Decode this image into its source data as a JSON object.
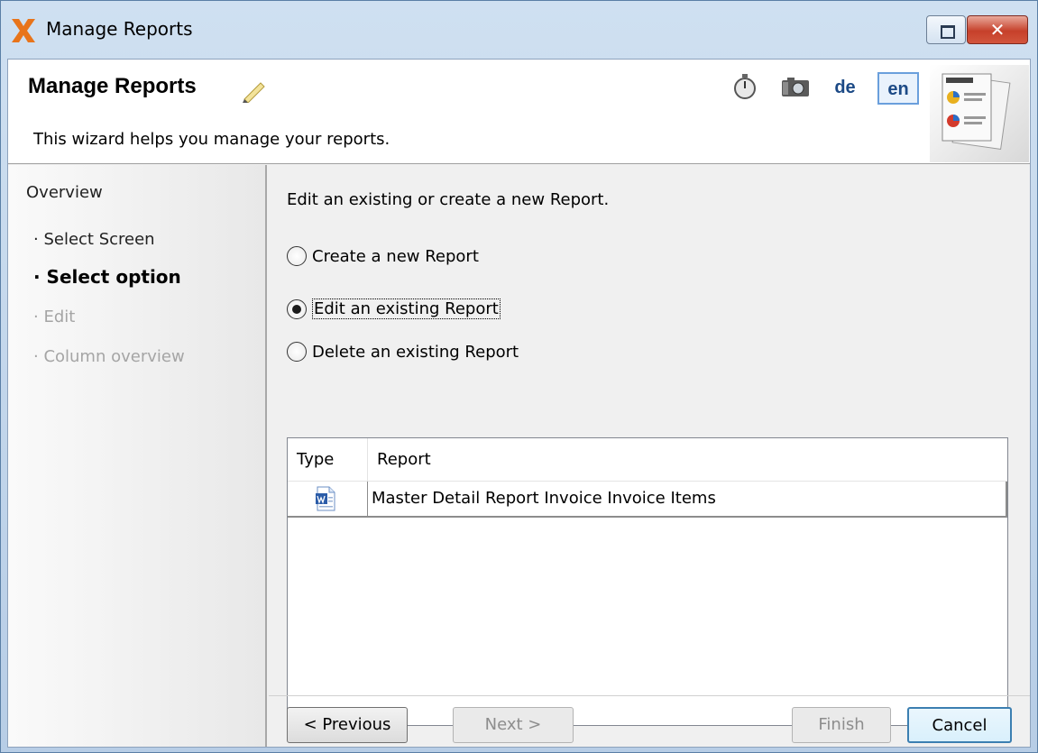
{
  "window": {
    "title": "Manage Reports"
  },
  "header": {
    "title": "Manage Reports",
    "subtitle": "This wizard helps you manage your reports.",
    "languages": [
      "de",
      "en"
    ],
    "selected_language": "en"
  },
  "sidebar": {
    "heading": "Overview",
    "steps": [
      {
        "label": "· Select Screen",
        "state": "done"
      },
      {
        "label": "· Select option",
        "state": "active"
      },
      {
        "label": "· Edit",
        "state": "disabled"
      },
      {
        "label": "· Column overview",
        "state": "disabled"
      }
    ]
  },
  "main": {
    "intro": "Edit an existing or create a new Report.",
    "options": [
      {
        "label": "Create a new Report",
        "checked": false
      },
      {
        "label": "Edit an existing Report",
        "checked": true
      },
      {
        "label": "Delete an existing Report",
        "checked": false
      }
    ],
    "table": {
      "columns": [
        "Type",
        "Report"
      ],
      "rows": [
        {
          "type_icon": "word-document-icon",
          "report": "Master Detail Report Invoice Invoice Items"
        }
      ]
    }
  },
  "footer": {
    "previous": "< Previous",
    "next": "Next >",
    "finish": "Finish",
    "cancel": "Cancel"
  },
  "colors": {
    "titlebar": "#b7cde6",
    "close_button": "#c6402a",
    "selected_lang_border": "#6a9fdc",
    "cancel_border": "#3c7fb1"
  }
}
